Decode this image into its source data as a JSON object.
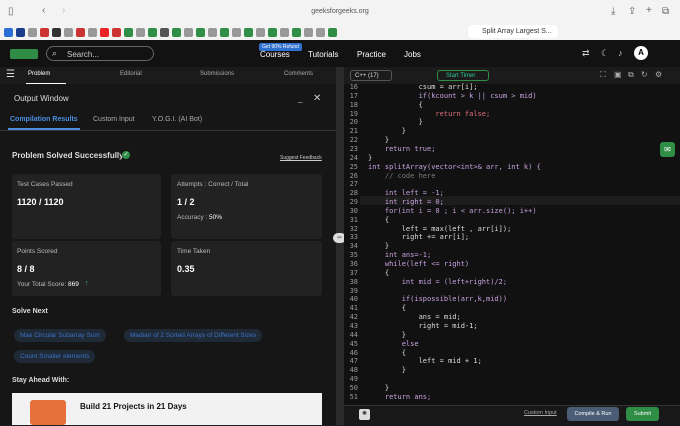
{
  "browser": {
    "url": "geeksforgeeks.org",
    "active_tab": "Split Array Largest S..."
  },
  "site": {
    "search_placeholder": "Search...",
    "promo_badge": "Get 90% Refund",
    "nav": [
      "Courses",
      "Tutorials",
      "Practice",
      "Jobs"
    ],
    "avatar_letter": "A"
  },
  "problem_tabs": [
    "Problem",
    "Editorial",
    "Submissions",
    "Comments"
  ],
  "editor_header": {
    "language": "C++ (17)",
    "timer": "Start Timer"
  },
  "output": {
    "title": "Output Window",
    "subtabs": [
      "Compilation Results",
      "Custom Input",
      "Y.O.G.I. (AI Bot)"
    ],
    "status": "Problem Solved Successfully",
    "feedback": "Suggest Feedback",
    "cards": {
      "test_label": "Test Cases Passed",
      "test_value": "1120 / 1120",
      "attempts_label": "Attempts : Correct / Total",
      "attempts_value": "1 / 2",
      "accuracy_label": "Accuracy :",
      "accuracy_value": "50%",
      "points_label": "Points Scored",
      "points_value": "8 / 8",
      "total_label": "Your Total Score:",
      "total_value": "869",
      "time_label": "Time Taken",
      "time_value": "0.35"
    },
    "solve_next_title": "Solve Next",
    "solve_next": [
      "Max Circular Subarray Sum",
      "Median of 2 Sorted Arrays of Different Sizes",
      "Count Smaller elements"
    ],
    "stay_ahead": "Stay Ahead With:",
    "ad_title": "Build 21 Projects in 21 Days"
  },
  "code": {
    "line_numbers": [
      "16",
      "17",
      "18",
      "19",
      "20",
      "21",
      "22",
      "23",
      "24",
      "25",
      "26",
      "27",
      "28",
      "29",
      "30",
      "31",
      "32",
      "33",
      "34",
      "35",
      "36",
      "37",
      "38",
      "39",
      "40",
      "41",
      "42",
      "43",
      "44",
      "45",
      "46",
      "47",
      "48",
      "49",
      "50",
      "51"
    ],
    "lines": [
      "            csum = arr[i];",
      "            if(kcount > k || csum > mid)",
      "            {",
      "                return false;",
      "            }",
      "        }",
      "    }",
      "    return true;",
      "}",
      "int splitArray(vector<int>& arr, int k) {",
      "    // code here",
      "",
      "    int left = -1;",
      "    int right = 0;",
      "    for(int i = 0 ; i < arr.size(); i++)",
      "    {",
      "        left = max(left , arr[i]);",
      "        right += arr[i];",
      "    }",
      "    int ans=-1;",
      "    while(left <= right)",
      "    {",
      "        int mid = (left+right)/2;",
      "",
      "        if(ispossible(arr,k,mid))",
      "        {",
      "            ans = mid;",
      "            right = mid-1;",
      "        }",
      "        else",
      "        {",
      "            left = mid + 1;",
      "        }",
      "",
      "    }",
      "    return ans;"
    ]
  },
  "actions": {
    "custom_input": "Custom Input",
    "compile": "Compile & Run",
    "submit": "Submit"
  }
}
